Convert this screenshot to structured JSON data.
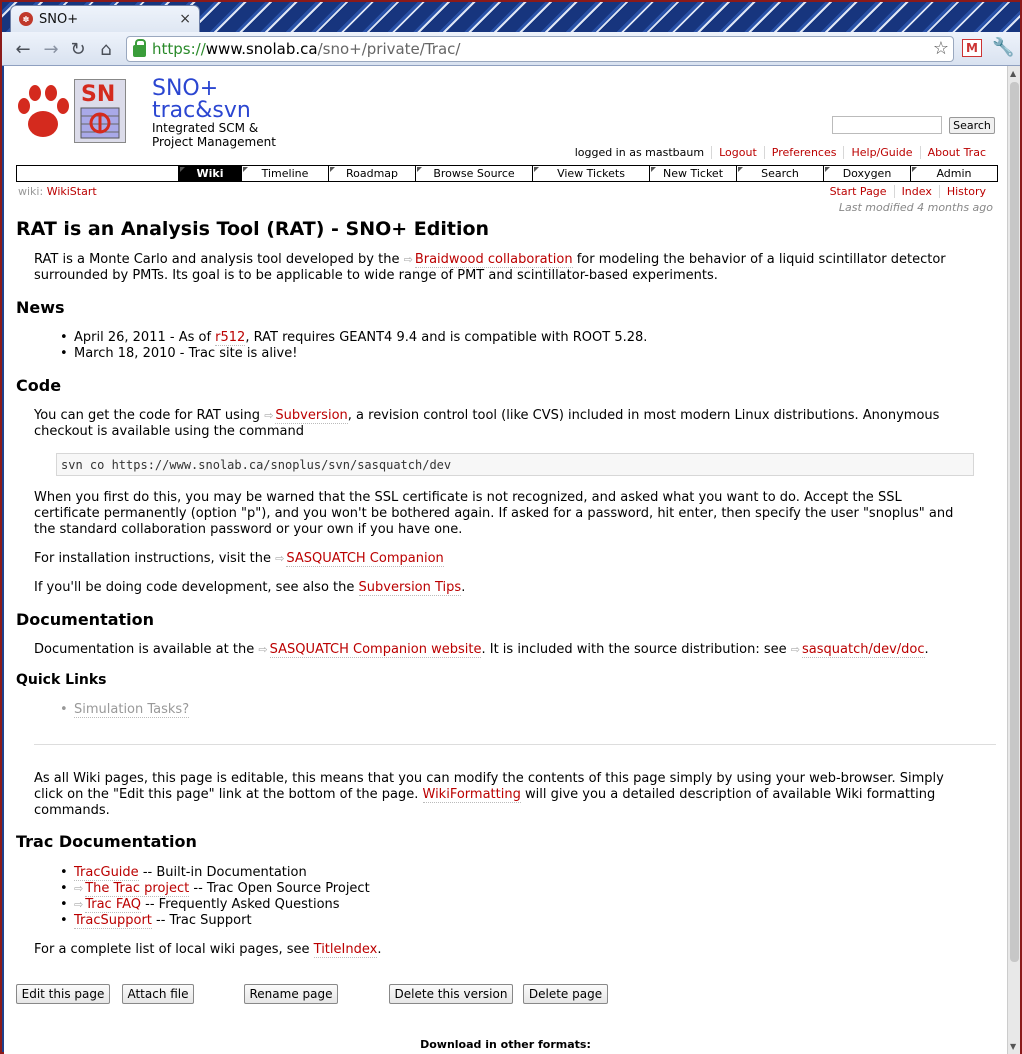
{
  "browser": {
    "tab_title": "SNO+",
    "tab_close": "×",
    "url_scheme": "https://",
    "url_host": "www.snolab.ca",
    "url_path": "/sno+/private/Trac/",
    "gmail_label": "M"
  },
  "header": {
    "logo_text": "SN",
    "brand_line1": "SNO+",
    "brand_line2": "trac&svn",
    "brand_line3": "Integrated SCM & Project Management",
    "search_button": "Search",
    "search_placeholder": ""
  },
  "metanav": {
    "logged_in": "logged in as mastbaum",
    "items": [
      "Logout",
      "Preferences",
      "Help/Guide",
      "About Trac"
    ]
  },
  "mainnav": {
    "items": [
      "Wiki",
      "Timeline",
      "Roadmap",
      "Browse Source",
      "View Tickets",
      "New Ticket",
      "Search",
      "Doxygen",
      "Admin"
    ],
    "active": "Wiki"
  },
  "ctxnav": {
    "prefix": "wiki:",
    "page": "WikiStart",
    "items": [
      "Start Page",
      "Index",
      "History"
    ],
    "last_modified": "Last modified 4 months ago"
  },
  "content": {
    "title": "RAT is an Analysis Tool (RAT) - SNO+ Edition",
    "intro_1": "RAT is a Monte Carlo and analysis tool developed by the",
    "intro_link": "Braidwood collaboration",
    "intro_2": "for modeling the behavior of a liquid scintillator detector",
    "intro_3": "surrounded by PMTs. Its goal is to be applicable to wide range of PMT and scintillator-based experiments.",
    "news_heading": "News",
    "news_1_a": "April 26, 2011 - As of",
    "news_1_link": "r512",
    "news_1_b": ", RAT requires GEANT4 9.4 and is compatible with ROOT 5.28.",
    "news_2": "March 18, 2010 - Trac site is alive!",
    "code_heading": "Code",
    "code_p1_a": "You can get the code for RAT using",
    "code_p1_link": "Subversion",
    "code_p1_b": ", a revision control tool (like CVS) included in most modern Linux distributions. Anonymous",
    "code_p1_c": "checkout is available using the command",
    "code_cmd": "svn co https://www.snolab.ca/snoplus/svn/sasquatch/dev",
    "code_p2_1": "When you first do this, you may be warned that the SSL certificate is not recognized, and asked what you want to do. Accept the SSL",
    "code_p2_2": "certificate permanently (option \"p\"), and you won't be bothered again. If asked for a password, hit enter, then specify the user \"snoplus\" and",
    "code_p2_3": "the standard collaboration password or your own if you have one.",
    "code_p3_a": "For installation instructions, visit the",
    "code_p3_link": "SASQUATCH Companion",
    "code_p4_a": "If you'll be doing code development, see also the",
    "code_p4_link": "Subversion Tips",
    "code_p4_b": ".",
    "doc_heading": "Documentation",
    "doc_a": "Documentation is available at the",
    "doc_link1": "SASQUATCH Companion website",
    "doc_b": ". It is included with the source distribution: see",
    "doc_link2": "sasquatch/dev/doc",
    "doc_c": ".",
    "quick_heading": "Quick Links",
    "quick_1": "Simulation Tasks?",
    "edit_1": "As all Wiki pages, this page is editable, this means that you can modify the contents of this page simply by using your web-browser. Simply",
    "edit_2_a": "click on the \"Edit this page\" link at the bottom of the page.",
    "edit_2_link": "WikiFormatting",
    "edit_2_b": "will give you a detailed description of available Wiki formatting",
    "edit_3": "commands.",
    "tracdoc_heading": "Trac Documentation",
    "td_1_link": "TracGuide",
    "td_1_text": "-- Built-in Documentation",
    "td_2_link": "The Trac project",
    "td_2_text": "-- Trac Open Source Project",
    "td_3_link": "Trac FAQ",
    "td_3_text": "-- Frequently Asked Questions",
    "td_4_link": "TracSupport",
    "td_4_text": "-- Trac Support",
    "complete_a": "For a complete list of local wiki pages, see",
    "complete_link": "TitleIndex",
    "complete_b": ".",
    "ext_icon": "⇨"
  },
  "buttons": {
    "edit": "Edit this page",
    "attach": "Attach file",
    "rename": "Rename page",
    "delete_version": "Delete this version",
    "delete_page": "Delete page"
  },
  "footer": {
    "download": "Download in other formats:"
  }
}
